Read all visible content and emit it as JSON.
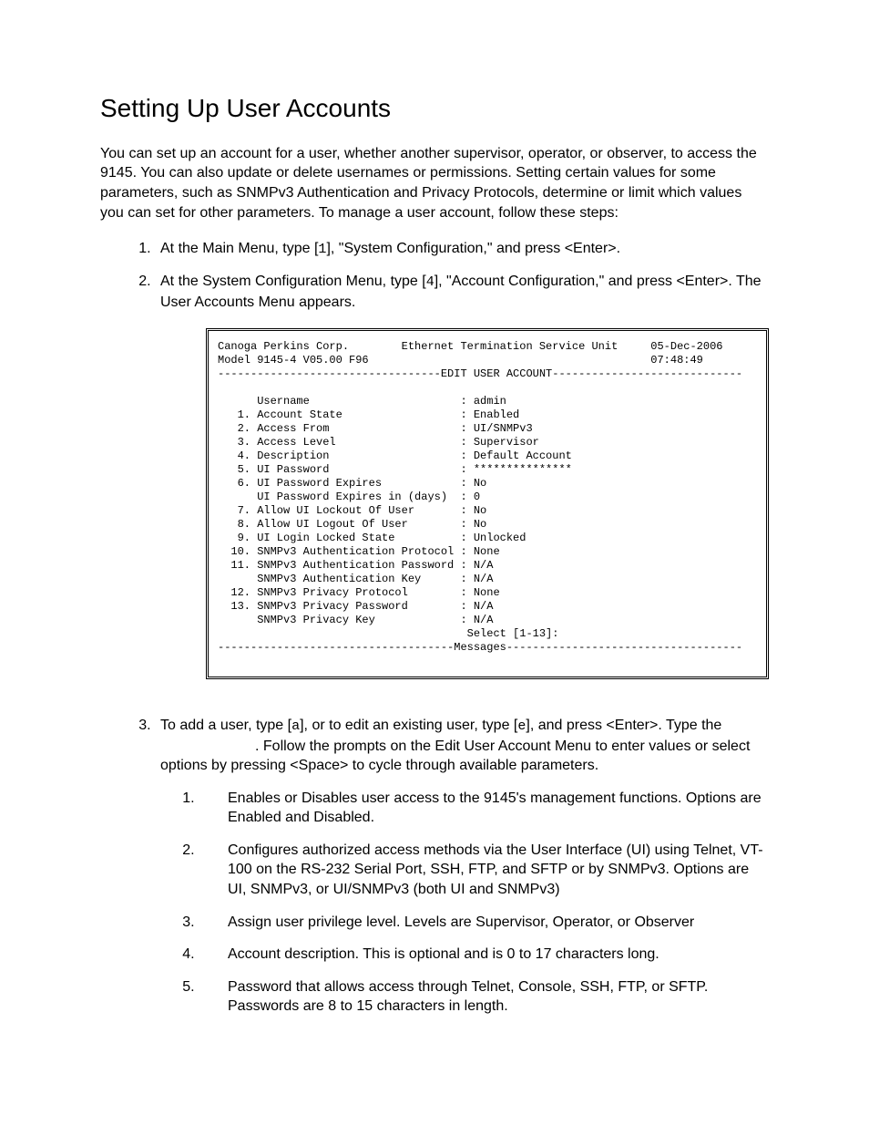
{
  "title": "Setting Up User Accounts",
  "intro": "You can set up an account for a user, whether another supervisor, operator, or observer, to access the 9145.  You can also update or delete usernames or permissions.  Setting certain values for some parameters, such as SNMPv3 Authentication and Privacy Protocols, determine or limit which values you can set for other parameters.  To manage a user account, follow these steps:",
  "step1_a": "At the Main Menu, type [",
  "step1_key": "1",
  "step1_b": "], \"System Configuration,\" and press <Enter>.",
  "step2_a": "At the System Configuration Menu, type [",
  "step2_key": "4",
  "step2_b": "], \"Account Configuration,\" and press <Enter>. The User Accounts Menu appears.",
  "terminal": {
    "h_company": "Canoga Perkins Corp.",
    "h_product": "Ethernet Termination Service Unit",
    "h_date": "05-Dec-2006",
    "h_model": "Model 9145-4 V05.00 F96",
    "h_time": "07:48:49",
    "rule_title": "----------------------------------EDIT USER ACCOUNT-----------------------------",
    "rows": [
      {
        "n": "   ",
        "label": "Username",
        "val": "admin"
      },
      {
        "n": " 1.",
        "label": "Account State",
        "val": "Enabled"
      },
      {
        "n": " 2.",
        "label": "Access From",
        "val": "UI/SNMPv3"
      },
      {
        "n": " 3.",
        "label": "Access Level",
        "val": "Supervisor"
      },
      {
        "n": " 4.",
        "label": "Description",
        "val": "Default Account"
      },
      {
        "n": " 5.",
        "label": "UI Password",
        "val": "***************"
      },
      {
        "n": " 6.",
        "label": "UI Password Expires",
        "val": "No"
      },
      {
        "n": "   ",
        "label": "UI Password Expires in (days)",
        "val": "0"
      },
      {
        "n": " 7.",
        "label": "Allow UI Lockout Of User",
        "val": "No"
      },
      {
        "n": " 8.",
        "label": "Allow UI Logout Of User",
        "val": "No"
      },
      {
        "n": " 9.",
        "label": "UI Login Locked State",
        "val": "Unlocked"
      },
      {
        "n": "10.",
        "label": "SNMPv3 Authentication Protocol",
        "val": "None"
      },
      {
        "n": "11.",
        "label": "SNMPv3 Authentication Password",
        "val": "N/A"
      },
      {
        "n": "   ",
        "label": "SNMPv3 Authentication Key",
        "val": "N/A"
      },
      {
        "n": "12.",
        "label": "SNMPv3 Privacy Protocol",
        "val": "None"
      },
      {
        "n": "13.",
        "label": "SNMPv3 Privacy Password",
        "val": "N/A"
      },
      {
        "n": "   ",
        "label": "SNMPv3 Privacy Key",
        "val": "N/A"
      }
    ],
    "select_prompt": "                                      Select [1-13]:",
    "rule_messages": "------------------------------------Messages------------------------------------"
  },
  "step3_a": "To add a user, type [",
  "step3_key_a": "a",
  "step3_b": "], or to edit an existing user, type [",
  "step3_key_e": "e",
  "step3_c": "], and press <Enter>.  Type the",
  "step3_d": ".  Follow the prompts on the Edit User Account Menu to enter values or select options by pressing <Space> to cycle through available parameters.",
  "opts": [
    "Enables or Disables user access to the 9145's management functions.  Options are Enabled and Disabled.",
    "Configures authorized access methods via the User Interface (UI) using Telnet, VT-100 on the RS-232 Serial Port, SSH, FTP, and SFTP or by SNMPv3.  Options are UI, SNMPv3, or UI/SNMPv3  (both UI and SNMPv3)",
    "Assign user privilege level.  Levels are Supervisor, Operator, or Observer",
    "Account description.  This is optional and is 0 to 17 characters long.",
    "Password that allows access through Telnet, Console, SSH, FTP, or SFTP.  Passwords are  8 to 15 characters in length."
  ]
}
